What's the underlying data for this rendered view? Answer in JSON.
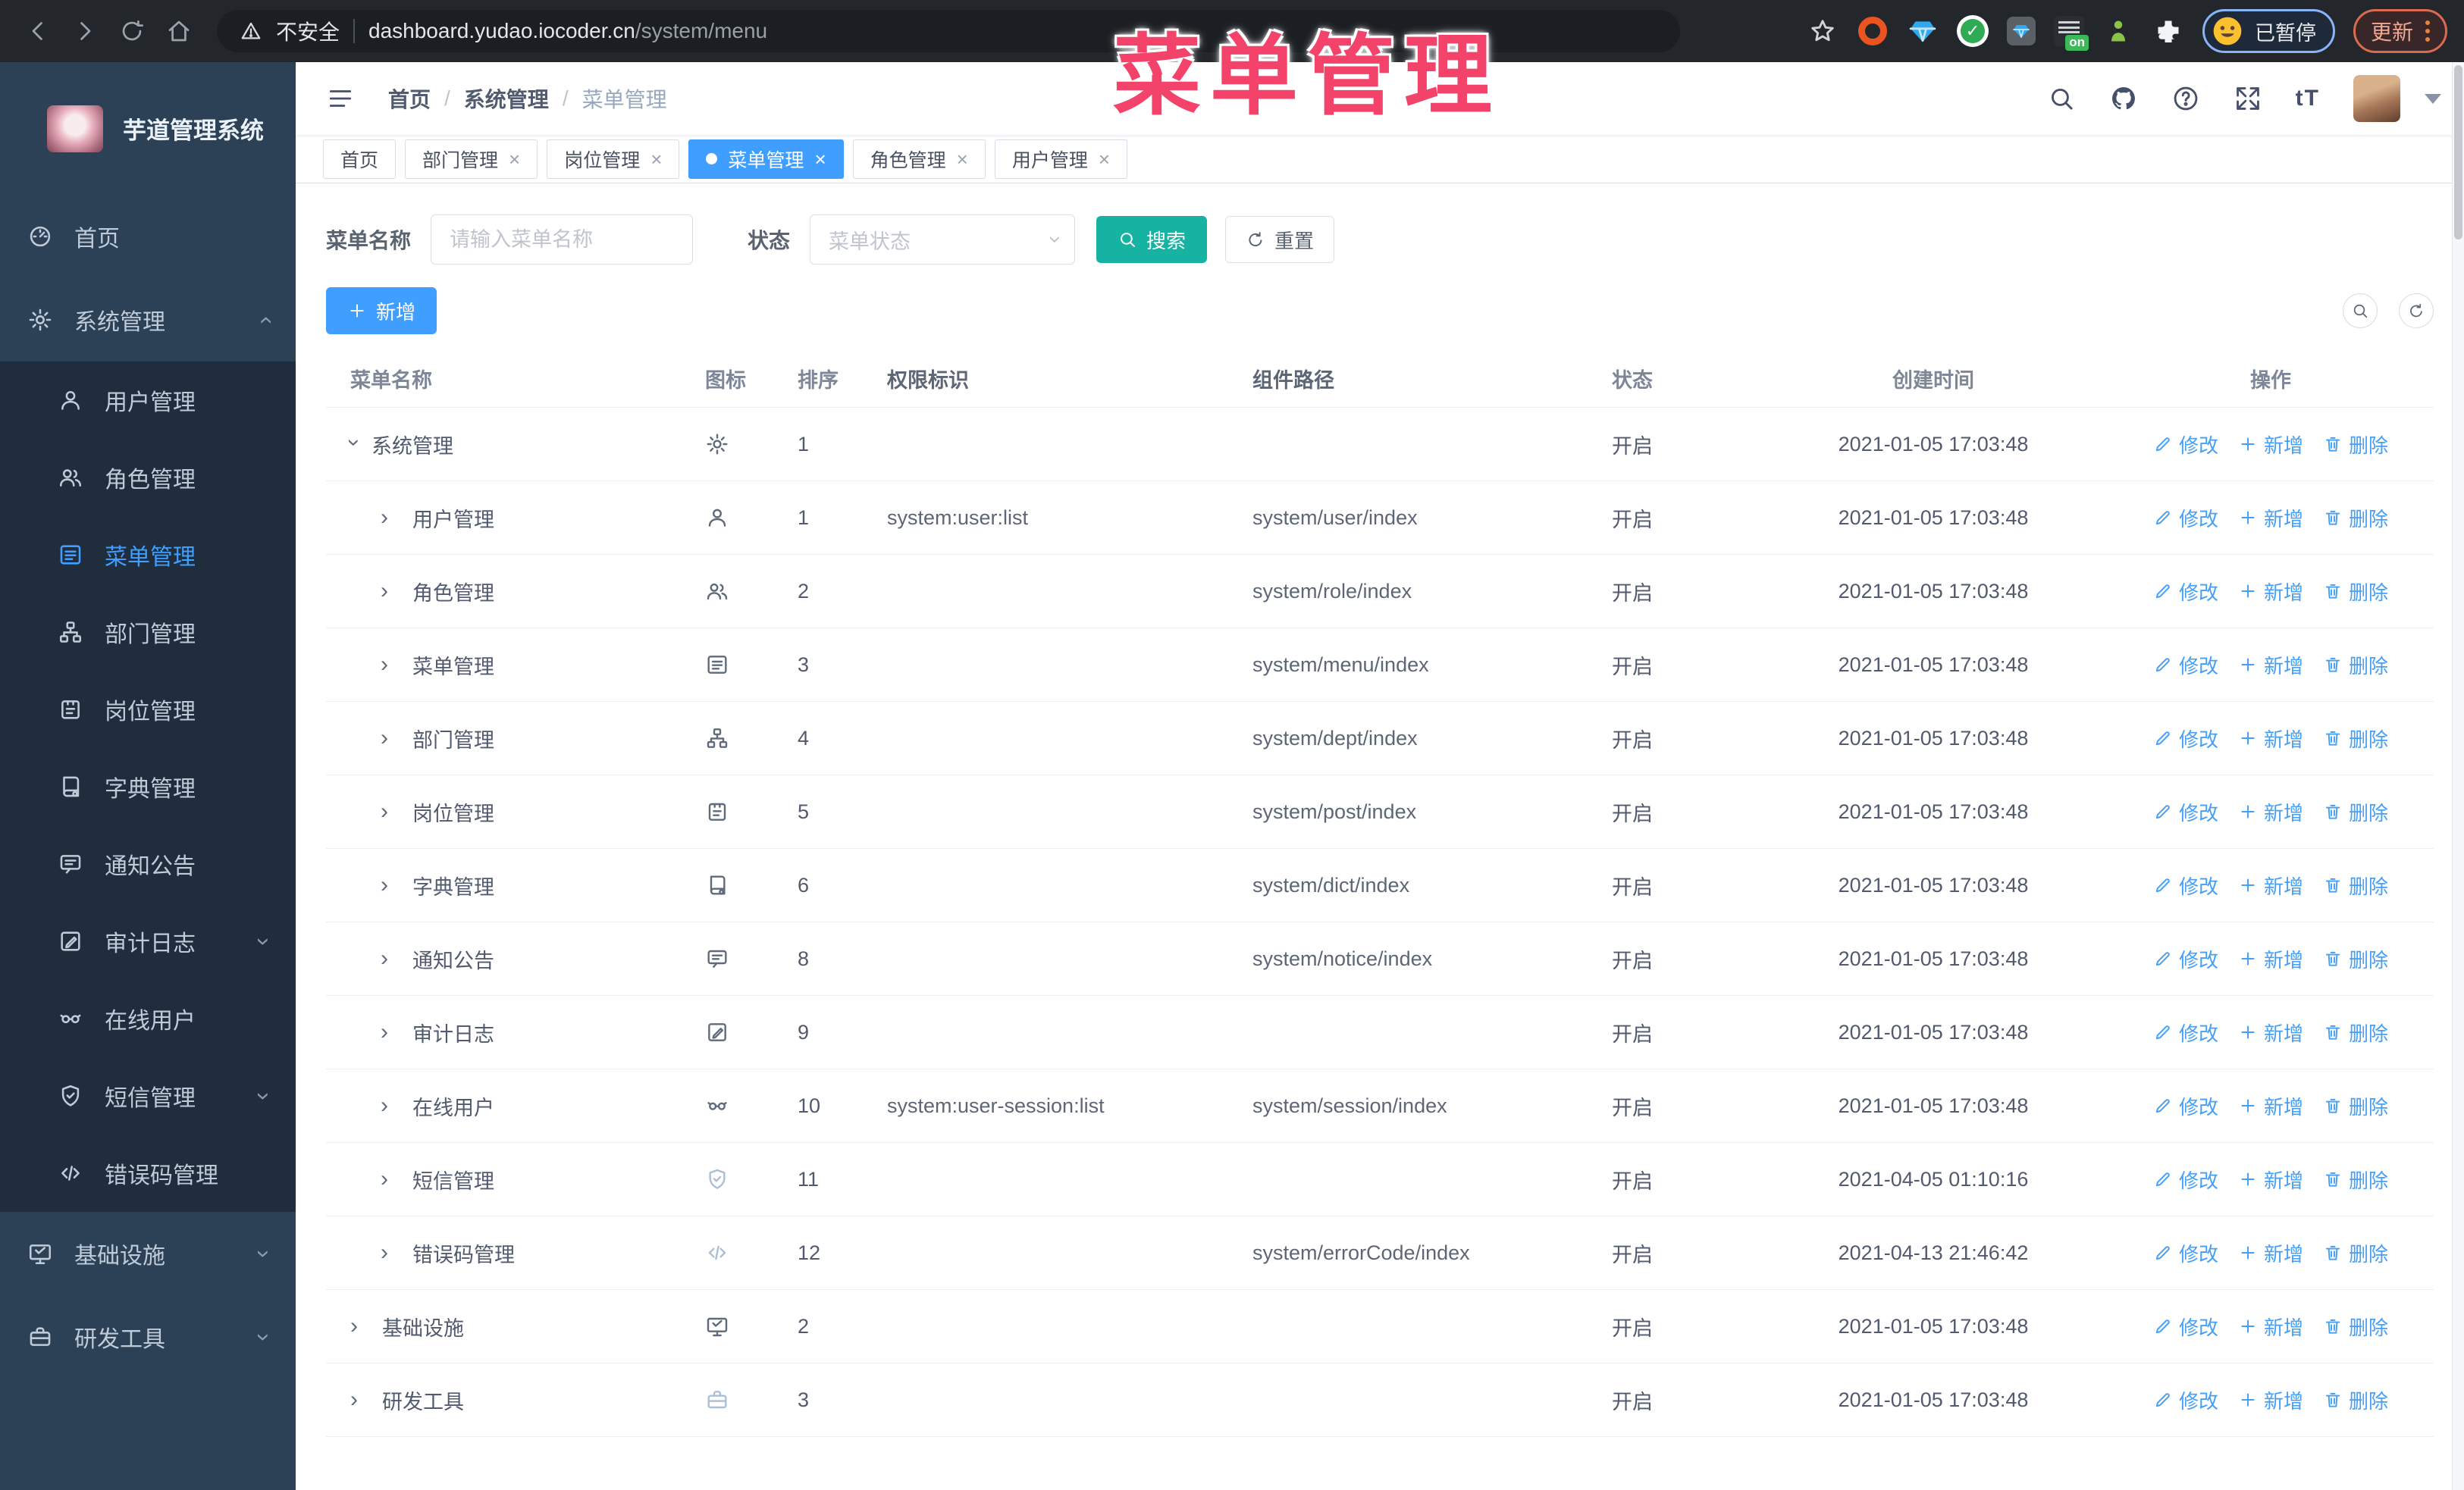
{
  "browser": {
    "security_label": "不安全",
    "url_host": "dashboard.yudao.iocoder.cn",
    "url_path": "/system/menu",
    "ext_on_badge": "on",
    "profile_status": "已暂停",
    "update_label": "更新"
  },
  "overlay_title": "菜单管理",
  "header": {
    "fontsize_glyph": "tT"
  },
  "sidebar": {
    "app_title": "芋道管理系统",
    "items": [
      {
        "label": "首页",
        "icon": "dashboard",
        "level": 0
      },
      {
        "label": "系统管理",
        "icon": "gear",
        "level": 0,
        "arrow": "up"
      },
      {
        "label": "用户管理",
        "icon": "user",
        "level": 1
      },
      {
        "label": "角色管理",
        "icon": "users",
        "level": 1
      },
      {
        "label": "菜单管理",
        "icon": "menu",
        "level": 1,
        "active": true
      },
      {
        "label": "部门管理",
        "icon": "tree",
        "level": 1
      },
      {
        "label": "岗位管理",
        "icon": "badge",
        "level": 1
      },
      {
        "label": "字典管理",
        "icon": "dict",
        "level": 1
      },
      {
        "label": "通知公告",
        "icon": "message",
        "level": 1
      },
      {
        "label": "审计日志",
        "icon": "edit",
        "level": 1,
        "arrow": "down"
      },
      {
        "label": "在线用户",
        "icon": "online",
        "level": 1
      },
      {
        "label": "短信管理",
        "icon": "shield",
        "level": 1,
        "arrow": "down"
      },
      {
        "label": "错误码管理",
        "icon": "code",
        "level": 1
      },
      {
        "label": "基础设施",
        "icon": "monitor",
        "level": 0,
        "arrow": "down"
      },
      {
        "label": "研发工具",
        "icon": "tool",
        "level": 0,
        "arrow": "down"
      }
    ]
  },
  "breadcrumb": [
    "首页",
    "系统管理",
    "菜单管理"
  ],
  "tabs": [
    {
      "label": "首页",
      "closable": false,
      "active": false
    },
    {
      "label": "部门管理",
      "closable": true,
      "active": false
    },
    {
      "label": "岗位管理",
      "closable": true,
      "active": false
    },
    {
      "label": "菜单管理",
      "closable": true,
      "active": true
    },
    {
      "label": "角色管理",
      "closable": true,
      "active": false
    },
    {
      "label": "用户管理",
      "closable": true,
      "active": false
    }
  ],
  "filters": {
    "name_label": "菜单名称",
    "name_placeholder": "请输入菜单名称",
    "status_label": "状态",
    "status_placeholder": "菜单状态",
    "search_label": "搜索",
    "reset_label": "重置"
  },
  "toolbar": {
    "add_label": "新增"
  },
  "table": {
    "columns": [
      "菜单名称",
      "图标",
      "排序",
      "权限标识",
      "组件路径",
      "状态",
      "创建时间",
      "操作"
    ],
    "action_labels": {
      "edit": "修改",
      "add": "新增",
      "delete": "删除"
    },
    "rows": [
      {
        "name": "系统管理",
        "level": 0,
        "expanded": true,
        "icon": "gear",
        "sort": "1",
        "perm": "",
        "path": "",
        "status": "开启",
        "time": "2021-01-05 17:03:48"
      },
      {
        "name": "用户管理",
        "level": 1,
        "icon": "user",
        "sort": "1",
        "perm": "system:user:list",
        "path": "system/user/index",
        "status": "开启",
        "time": "2021-01-05 17:03:48"
      },
      {
        "name": "角色管理",
        "level": 1,
        "icon": "users",
        "sort": "2",
        "perm": "",
        "path": "system/role/index",
        "status": "开启",
        "time": "2021-01-05 17:03:48"
      },
      {
        "name": "菜单管理",
        "level": 1,
        "icon": "menu",
        "sort": "3",
        "perm": "",
        "path": "system/menu/index",
        "status": "开启",
        "time": "2021-01-05 17:03:48"
      },
      {
        "name": "部门管理",
        "level": 1,
        "icon": "tree",
        "sort": "4",
        "perm": "",
        "path": "system/dept/index",
        "status": "开启",
        "time": "2021-01-05 17:03:48"
      },
      {
        "name": "岗位管理",
        "level": 1,
        "icon": "badge",
        "sort": "5",
        "perm": "",
        "path": "system/post/index",
        "status": "开启",
        "time": "2021-01-05 17:03:48"
      },
      {
        "name": "字典管理",
        "level": 1,
        "icon": "dict",
        "sort": "6",
        "perm": "",
        "path": "system/dict/index",
        "status": "开启",
        "time": "2021-01-05 17:03:48"
      },
      {
        "name": "通知公告",
        "level": 1,
        "icon": "message",
        "sort": "8",
        "perm": "",
        "path": "system/notice/index",
        "status": "开启",
        "time": "2021-01-05 17:03:48"
      },
      {
        "name": "审计日志",
        "level": 1,
        "icon": "edit",
        "sort": "9",
        "perm": "",
        "path": "",
        "status": "开启",
        "time": "2021-01-05 17:03:48"
      },
      {
        "name": "在线用户",
        "level": 1,
        "icon": "online",
        "sort": "10",
        "perm": "system:user-session:list",
        "path": "system/session/index",
        "status": "开启",
        "time": "2021-01-05 17:03:48"
      },
      {
        "name": "短信管理",
        "level": 1,
        "icon": "shield",
        "light": true,
        "sort": "11",
        "perm": "",
        "path": "",
        "status": "开启",
        "time": "2021-04-05 01:10:16"
      },
      {
        "name": "错误码管理",
        "level": 1,
        "icon": "code",
        "light": true,
        "sort": "12",
        "perm": "",
        "path": "system/errorCode/index",
        "status": "开启",
        "time": "2021-04-13 21:46:42"
      },
      {
        "name": "基础设施",
        "level": 0,
        "icon": "monitor",
        "sort": "2",
        "perm": "",
        "path": "",
        "status": "开启",
        "time": "2021-01-05 17:03:48"
      },
      {
        "name": "研发工具",
        "level": 0,
        "icon": "tool",
        "light": true,
        "sort": "3",
        "perm": "",
        "path": "",
        "status": "开启",
        "time": "2021-01-05 17:03:48"
      }
    ]
  }
}
